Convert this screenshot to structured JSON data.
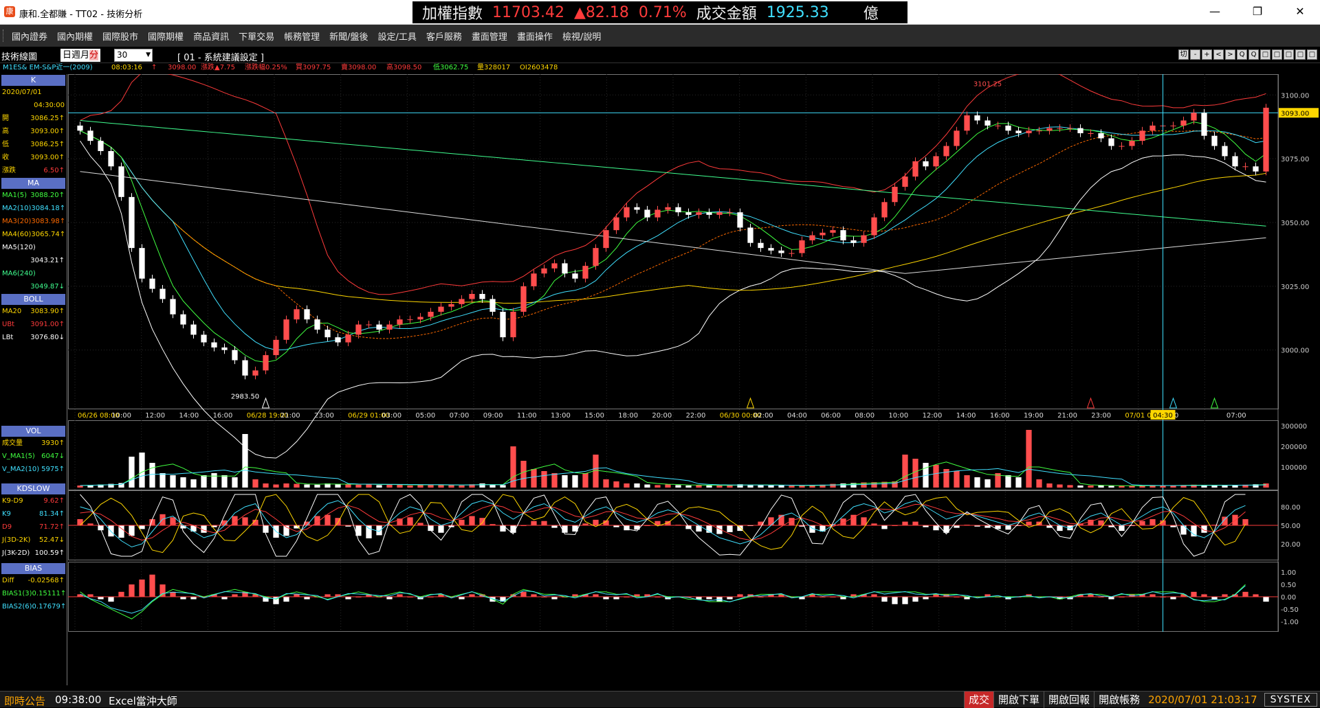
{
  "window": {
    "title": "康和.全都賺 - TT02 - 技術分析",
    "logo": "康"
  },
  "ticker": {
    "index_label": "加權指數",
    "index_value": "11703.42",
    "change": "▲82.18",
    "change_pct": "0.71%",
    "volume_label": "成交金額",
    "volume_value": "1925.33",
    "unit": "億"
  },
  "menu": [
    "國內證券",
    "國內期權",
    "國際股市",
    "國際期權",
    "商品資訊",
    "下單交易",
    "帳務管理",
    "新聞/盤後",
    "設定/工具",
    "客戶服務",
    "畫面管理",
    "畫面操作",
    "檢視/說明"
  ],
  "toolbar": {
    "title": "技術線圖",
    "periods": [
      "日",
      "週",
      "月",
      "分"
    ],
    "selected_period": "分",
    "interval_value": "30",
    "setting_label": "[ 01 - 系統建議設定 ]",
    "icons": [
      "切",
      "-",
      "+",
      "<",
      ">",
      "Q",
      "Q",
      "□",
      "□",
      "□",
      "□",
      "□"
    ]
  },
  "quote": {
    "symbol": "M1ES& EM-S&P近一(2009)",
    "time": "08:03:16",
    "arrow": "↑",
    "price": "3098.00",
    "chg": "漲跌▲7.75",
    "chg_pct": "漲跌幅0.25%",
    "bid": "買3097.75",
    "ask": "賣3098.00",
    "high": "高3098.50",
    "low": "低3062.75",
    "vol": "量328017",
    "oi": "OI2603478"
  },
  "panel": {
    "k_head": "K",
    "date": "2020/07/01",
    "time": "04:30:00",
    "ohlc": [
      {
        "label": "開",
        "value": "3086.25↑"
      },
      {
        "label": "高",
        "value": "3093.00↑"
      },
      {
        "label": "低",
        "value": "3086.25↑"
      },
      {
        "label": "收",
        "value": "3093.00↑"
      },
      {
        "label": "漲跌",
        "value": "6.50↑"
      }
    ],
    "ma_head": "MA",
    "ma": [
      {
        "label": "MA1(5)",
        "value": "3088.20↑"
      },
      {
        "label": "MA2(10)",
        "value": "3084.18↑"
      },
      {
        "label": "MA3(20)",
        "value": "3083.98↑"
      },
      {
        "label": "MA4(60)",
        "value": "3065.74↑"
      }
    ],
    "ma5_label": "MA5(120)",
    "ma5_value": "3043.21↑",
    "ma6_label": "MA6(240)",
    "ma6_value": "3049.87↓",
    "boll_head": "BOLL",
    "boll": [
      {
        "label": "MA20",
        "value": "3083.90↑"
      },
      {
        "label": "UBt",
        "value": "3091.00↑"
      },
      {
        "label": "LBt",
        "value": "3076.80↓"
      }
    ],
    "vol_head": "VOL",
    "vol": [
      {
        "label": "成交量",
        "value": "3930↑"
      },
      {
        "label": "V_MA1(5)",
        "value": "6047↓"
      },
      {
        "label": "V_MA2(10)",
        "value": "5975↑"
      }
    ],
    "kd_head": "KDSLOW",
    "kd": [
      {
        "label": "K9-D9",
        "value": "9.62↑"
      },
      {
        "label": "K9",
        "value": "81.34↑"
      },
      {
        "label": "D9",
        "value": "71.72↑"
      },
      {
        "label": "J(3D-2K)",
        "value": "52.47↓"
      },
      {
        "label": "J(3K-2D)",
        "value": "100.59↑"
      }
    ],
    "bias_head": "BIAS",
    "bias": [
      {
        "label": "Diff",
        "value": "-0.02568↑"
      },
      {
        "label": "BIAS1(3)",
        "value": "0.15111↑"
      },
      {
        "label": "BIAS2(6)",
        "value": "0.17679↑"
      }
    ]
  },
  "chart_data": {
    "type": "candlestick",
    "price_axis": [
      "3100.00",
      "3075.00",
      "3050.00",
      "3025.00",
      "3000.00"
    ],
    "last_price_tag": "3093.00",
    "high_label": "3101.25",
    "low_label": "2983.50",
    "time_labels": [
      "06/26 08:00",
      "10:00",
      "12:00",
      "14:00",
      "16:00",
      "06/28 19:00",
      "21:00",
      "23:00",
      "06/29 01:00",
      "03:00",
      "05:00",
      "07:00",
      "09:00",
      "11:00",
      "13:00",
      "15:00",
      "18:00",
      "20:00",
      "22:00",
      "06/30 00:00",
      "02:00",
      "04:00",
      "06:00",
      "08:00",
      "10:00",
      "12:00",
      "14:00",
      "16:00",
      "19:00",
      "21:00",
      "23:00",
      "07/01 01:00",
      "03:00",
      "04:30",
      "07:00"
    ],
    "cursor_time": "04:30",
    "vol_axis": [
      "300000",
      "200000",
      "100000"
    ],
    "kd_axis": [
      "80.00",
      "50.00",
      "20.00"
    ],
    "bias_axis": [
      "1.00",
      "0.50",
      "0.00",
      "-0.50",
      "-1.00"
    ],
    "closes": [
      3086,
      3082,
      3078,
      3072,
      3060,
      3040,
      3028,
      3024,
      3020,
      3014,
      3010,
      3006,
      3003,
      3001,
      3000,
      2996,
      2990,
      2992,
      2998,
      3004,
      3012,
      3016,
      3012,
      3008,
      3005,
      3003,
      3006,
      3010,
      3010,
      3008,
      3010,
      3012,
      3012,
      3013,
      3015,
      3017,
      3018,
      3020,
      3022,
      3020,
      3015,
      3005,
      3015,
      3025,
      3030,
      3032,
      3034,
      3030,
      3028,
      3033,
      3040,
      3047,
      3052,
      3056,
      3055,
      3052,
      3055,
      3056,
      3054,
      3053,
      3054,
      3053,
      3054,
      3054,
      3048,
      3042,
      3040,
      3039,
      3038,
      3038,
      3043,
      3045,
      3046,
      3047,
      3043,
      3042,
      3045,
      3052,
      3058,
      3064,
      3068,
      3074,
      3072,
      3076,
      3080,
      3086,
      3092,
      3090,
      3088,
      3088,
      3086,
      3085,
      3086,
      3086,
      3087,
      3087,
      3087,
      3085,
      3085,
      3083,
      3080,
      3080,
      3082,
      3086,
      3088,
      3088,
      3088,
      3090,
      3093,
      3084,
      3080,
      3076,
      3072,
      3072,
      3070,
      3095
    ],
    "volumes": [
      10,
      12,
      15,
      18,
      22,
      150,
      170,
      120,
      70,
      60,
      50,
      40,
      60,
      70,
      60,
      50,
      260,
      40,
      20,
      15,
      20,
      18,
      15,
      14,
      20,
      16,
      18,
      14,
      15,
      12,
      16,
      14,
      10,
      12,
      15,
      14,
      12,
      10,
      16,
      20,
      14,
      12,
      200,
      130,
      90,
      80,
      70,
      60,
      60,
      70,
      160,
      40,
      30,
      20,
      20,
      15,
      12,
      15,
      12,
      10,
      12,
      10,
      10,
      12,
      16,
      14,
      12,
      10,
      10,
      9,
      10,
      12,
      14,
      18,
      20,
      22,
      25,
      26,
      28,
      30,
      160,
      140,
      120,
      110,
      90,
      80,
      60,
      50,
      40,
      70,
      60,
      50,
      280,
      40,
      20,
      15,
      12,
      10,
      10,
      10,
      8,
      8,
      8,
      10,
      12,
      10,
      10,
      12,
      14,
      12,
      10,
      10,
      12,
      14,
      16,
      20
    ],
    "kd_k": [
      80,
      75,
      60,
      40,
      25,
      15,
      20,
      40,
      60,
      65,
      50,
      40,
      30,
      35,
      50,
      70,
      80,
      85,
      60,
      40,
      30,
      35,
      50,
      70,
      85,
      90,
      80,
      60,
      45,
      40,
      55,
      70,
      80,
      75,
      60,
      50,
      55,
      70,
      85,
      90,
      85,
      70,
      60,
      70,
      80,
      85,
      75,
      60,
      55,
      65,
      75,
      80,
      70,
      60,
      55,
      60,
      70,
      75,
      70,
      60,
      50,
      40,
      30,
      25,
      20,
      25,
      35,
      50,
      65,
      70,
      60,
      45,
      40,
      50,
      65,
      80,
      85,
      80,
      70,
      75,
      85,
      90,
      80,
      70,
      60,
      65,
      70,
      65,
      60,
      55,
      50,
      55,
      65,
      70,
      60,
      50,
      45,
      55,
      65,
      70,
      60,
      50,
      55,
      65,
      75,
      80,
      70,
      50,
      35,
      30,
      40,
      60,
      75,
      82
    ],
    "kd_d": [
      70,
      72,
      68,
      58,
      45,
      32,
      26,
      30,
      42,
      52,
      55,
      50,
      42,
      38,
      42,
      55,
      67,
      76,
      72,
      60,
      47,
      40,
      44,
      55,
      68,
      78,
      82,
      77,
      66,
      56,
      54,
      59,
      67,
      71,
      69,
      62,
      58,
      61,
      70,
      78,
      83,
      80,
      72,
      70,
      73,
      78,
      79,
      72,
      65,
      62,
      66,
      72,
      73,
      68,
      62,
      60,
      63,
      68,
      69,
      66,
      60,
      52,
      44,
      36,
      29,
      26,
      29,
      37,
      48,
      58,
      62,
      57,
      50,
      48,
      54,
      63,
      72,
      77,
      76,
      75,
      79,
      84,
      83,
      78,
      72,
      69,
      69,
      67,
      64,
      61,
      57,
      56,
      59,
      64,
      64,
      59,
      53,
      52,
      56,
      62,
      63,
      59,
      56,
      58,
      65,
      72,
      73,
      65,
      53,
      42,
      39,
      46,
      58,
      72
    ],
    "bias1": [
      0.2,
      -0.1,
      -0.3,
      -0.5,
      -0.7,
      -0.9,
      -0.6,
      -0.2,
      0.1,
      0.3,
      0.2,
      0.1,
      0.0,
      0.1,
      0.2,
      0.3,
      0.2,
      0.1,
      0.0,
      -0.1,
      0.1,
      0.2,
      0.1,
      0.0,
      -0.1,
      0.0,
      0.1,
      0.2,
      0.1,
      0.0,
      0.1,
      0.2,
      0.1,
      0.0,
      0.1,
      0.1,
      0.0,
      0.1,
      0.2,
      0.1,
      -0.1,
      -0.3,
      0.1,
      0.3,
      0.2,
      0.1,
      0.1,
      0.0,
      0.0,
      0.1,
      0.2,
      0.2,
      0.1,
      0.1,
      0.0,
      0.0,
      0.1,
      0.0,
      0.0,
      -0.1,
      -0.1,
      -0.2,
      -0.2,
      -0.2,
      -0.1,
      0.0,
      0.1,
      0.1,
      0.1,
      0.0,
      0.0,
      0.1,
      0.1,
      0.1,
      0.0,
      0.0,
      0.1,
      0.2,
      0.2,
      0.2,
      0.2,
      0.2,
      0.1,
      0.1,
      0.1,
      0.1,
      0.0,
      0.0,
      0.0,
      0.0,
      0.0,
      0.0,
      0.0,
      0.0,
      0.0,
      -0.1,
      0.0,
      0.1,
      0.1,
      0.1,
      0.0,
      0.1,
      0.1,
      0.1,
      0.2,
      0.2,
      0.2,
      0.1,
      -0.1,
      -0.2,
      -0.2,
      -0.1,
      0.1,
      0.5
    ],
    "bias_diff": [
      0.1,
      0.1,
      -0.1,
      -0.2,
      0.2,
      0.5,
      0.7,
      0.9,
      0.5,
      0.2,
      -0.1,
      -0.1,
      0.0,
      0.1,
      -0.1,
      0.1,
      0.2,
      0.1,
      -0.2,
      -0.3,
      -0.2,
      0.1,
      -0.1,
      0.0,
      0.1,
      0.1,
      -0.1,
      0.0,
      0.1,
      0.0,
      -0.1,
      0.1,
      0.0,
      -0.1,
      0.0,
      0.1,
      0.0,
      -0.1,
      0.1,
      0.1,
      -0.2,
      -0.2,
      0.1,
      0.2,
      0.1,
      0.0,
      -0.1,
      0.0,
      0.1,
      0.1,
      0.1,
      -0.1,
      -0.1,
      0.0,
      0.1,
      0.1,
      0.0,
      -0.1,
      0.0,
      0.0,
      -0.1,
      -0.1,
      -0.2,
      -0.1,
      0.1,
      0.1,
      0.0,
      0.1,
      0.1,
      0.0,
      -0.1,
      0.1,
      0.0,
      0.0,
      -0.1,
      0.1,
      0.1,
      0.1,
      -0.2,
      -0.3,
      -0.3,
      -0.2,
      -0.1,
      0.1,
      0.1,
      0.0,
      -0.1,
      0.0,
      0.1,
      0.0,
      -0.1,
      0.0,
      0.1,
      0.0,
      0.0,
      -0.1,
      -0.1,
      0.1,
      0.1,
      0.0,
      -0.1,
      0.0,
      0.1,
      0.1,
      0.1,
      0.0,
      -0.1,
      0.1,
      0.2,
      0.1,
      -0.1,
      0.1,
      0.1,
      0.2,
      0.1,
      -0.2
    ]
  },
  "status": {
    "label": "即時公告",
    "time": "09:38:00",
    "news": "Excel當沖大師",
    "buttons": [
      "成交",
      "開啟下單",
      "開啟回報",
      "開啟帳務"
    ],
    "clock": "2020/07/01 21:03:17",
    "brand": "SYSTEX"
  }
}
